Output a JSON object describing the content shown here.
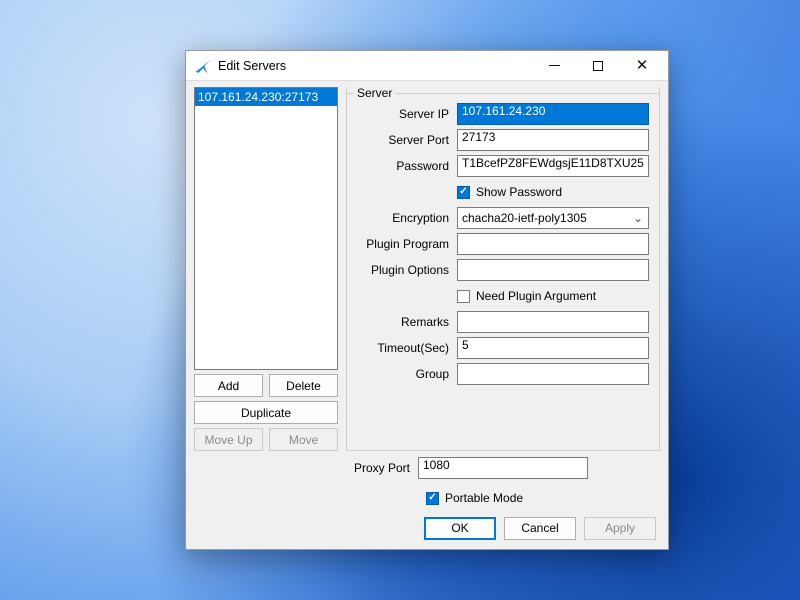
{
  "window": {
    "title": "Edit Servers"
  },
  "servers_list": {
    "items": [
      "107.161.24.230:27173"
    ],
    "selected_index": 0
  },
  "left_buttons": {
    "add": "Add",
    "delete": "Delete",
    "duplicate": "Duplicate",
    "move_up": "Move Up",
    "move_down": "Move"
  },
  "group": {
    "legend": "Server",
    "labels": {
      "server_ip": "Server IP",
      "server_port": "Server Port",
      "password": "Password",
      "show_password": "Show Password",
      "encryption": "Encryption",
      "plugin_program": "Plugin Program",
      "plugin_options": "Plugin Options",
      "need_plugin_arg": "Need Plugin Argument",
      "remarks": "Remarks",
      "timeout": "Timeout(Sec)",
      "group_field": "Group"
    },
    "values": {
      "server_ip": "107.161.24.230",
      "server_port": "27173",
      "password": "T1BcefPZ8FEWdgsjE11D8TXU25",
      "show_password_checked": true,
      "encryption": "chacha20-ietf-poly1305",
      "plugin_program": "",
      "plugin_options": "",
      "need_plugin_arg_checked": false,
      "remarks": "",
      "timeout": "5",
      "group_field": ""
    }
  },
  "proxy": {
    "label": "Proxy Port",
    "value": "1080"
  },
  "portable": {
    "label": "Portable Mode",
    "checked": true
  },
  "dialog_buttons": {
    "ok": "OK",
    "cancel": "Cancel",
    "apply": "Apply"
  }
}
